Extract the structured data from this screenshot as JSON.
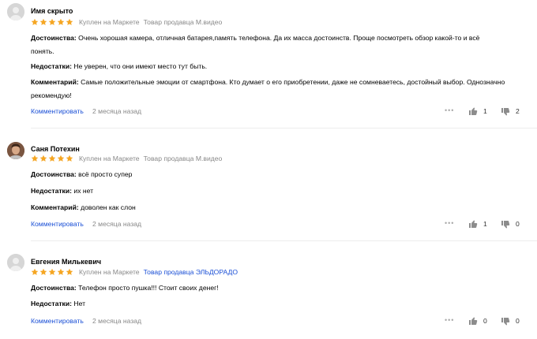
{
  "reviews": [
    {
      "author": "Имя скрыто",
      "rating": 5,
      "purchase": "Куплен на Маркете",
      "seller": "Товар продавца М.видео",
      "pros_label": "Достоинства:",
      "pros_line1": "Очень хорошая камера, отличная батарея,память телефона. Да их масса достоинств. Проще посмотреть обзор какой-то и всё",
      "pros_line2": "понять.",
      "cons_label": "Недостатки:",
      "cons": "Не уверен, что они имеют место тут быть.",
      "comment_label": "Комментарий:",
      "comment_line1": "Самые положительные эмоции от смартфона. Кто думает о его приобретении, даже не сомневаетесь, достойный выбор. Однозначно",
      "comment_line2": "рекомендую!",
      "comment_link": "Комментировать",
      "date": "2 месяца назад",
      "likes": "1",
      "dislikes": "2",
      "more": "•••"
    },
    {
      "author": "Саня Потехин",
      "rating": 5,
      "purchase": "Куплен на Маркете",
      "seller": "Товар продавца М.видео",
      "pros_label": "Достоинства:",
      "pros": "всё просто супер",
      "cons_label": "Недостатки:",
      "cons": "их нет",
      "comment_label": "Комментарий:",
      "comment": "доволен как слон",
      "comment_link": "Комментировать",
      "date": "2 месяца назад",
      "likes": "1",
      "dislikes": "0",
      "more": "•••"
    },
    {
      "author": "Евгения Милькевич",
      "rating": 5,
      "purchase": "Куплен на Маркете",
      "seller": "Товар продавца ЭЛЬДОРАДО",
      "pros_label": "Достоинства:",
      "pros": "Телефон просто пушка!!! Стоит своих денег!",
      "cons_label": "Недостатки:",
      "cons": "Нет",
      "comment_link": "Комментировать",
      "date": "2 месяца назад",
      "likes": "0",
      "dislikes": "0",
      "more": "•••"
    }
  ],
  "colors": {
    "star": "#f5a623",
    "link": "#1a4fd6",
    "muted": "#888888"
  },
  "icons": {
    "avatar_placeholder": "person-silhouette-icon",
    "avatar_photo": "user-photo-avatar",
    "like": "thumbs-up-icon",
    "dislike": "thumbs-down-icon",
    "star": "star-icon",
    "more": "more-dots-icon"
  }
}
